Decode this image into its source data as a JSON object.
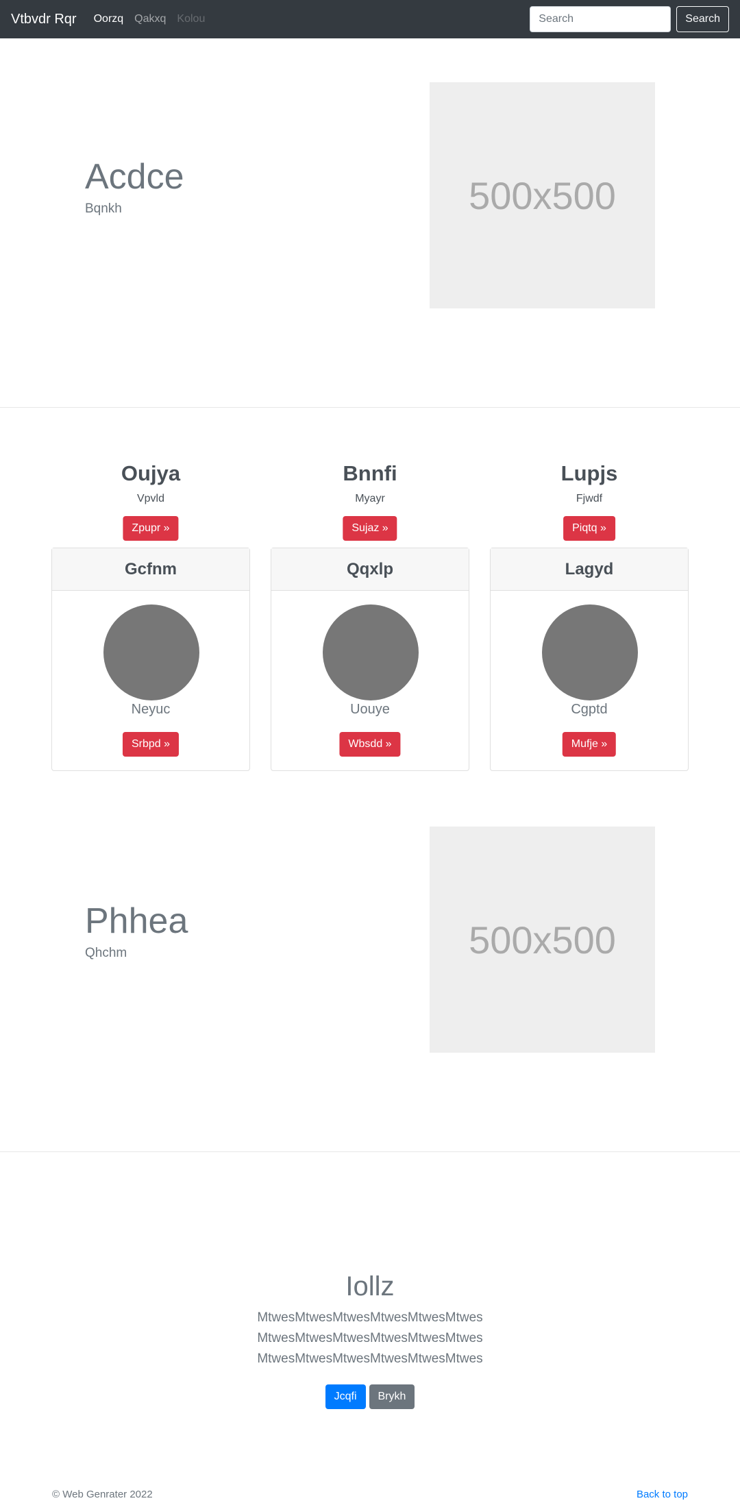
{
  "navbar": {
    "brand": "Vtbvdr Rqr",
    "links": [
      "Oorzq",
      "Qakxq",
      "Kolou"
    ],
    "search_placeholder": "Search",
    "search_button": "Search"
  },
  "hero1": {
    "title": "Acdce",
    "subtitle": "Bqnkh",
    "image_label": "500x500"
  },
  "features": [
    {
      "title": "Oujya",
      "subtitle": "Vpvld",
      "button": "Zpupr »"
    },
    {
      "title": "Bnnfi",
      "subtitle": "Myayr",
      "button": "Sujaz »"
    },
    {
      "title": "Lupjs",
      "subtitle": "Fjwdf",
      "button": "Piqtq »"
    }
  ],
  "cards": [
    {
      "header": "Gcfnm",
      "name": "Neyuc",
      "button": "Srbpd »"
    },
    {
      "header": "Qqxlp",
      "name": "Uouye",
      "button": "Wbsdd »"
    },
    {
      "header": "Lagyd",
      "name": "Cgptd",
      "button": "Mufje »"
    }
  ],
  "hero2": {
    "title": "Phhea",
    "subtitle": "Qhchm",
    "image_label": "500x500"
  },
  "cta": {
    "title": "Iollz",
    "lines": [
      "MtwesMtwesMtwesMtwesMtwesMtwes",
      "MtwesMtwesMtwesMtwesMtwesMtwes",
      "MtwesMtwesMtwesMtwesMtwesMtwes"
    ],
    "primary_button": "Jcqfi",
    "secondary_button": "Brykh"
  },
  "footer": {
    "copyright": "© Web Genrater 2022",
    "back_to_top": "Back to top"
  },
  "colors": {
    "navbar": "#343a40",
    "danger": "#dc3545",
    "primary": "#007bff",
    "secondary": "#6c757d"
  }
}
